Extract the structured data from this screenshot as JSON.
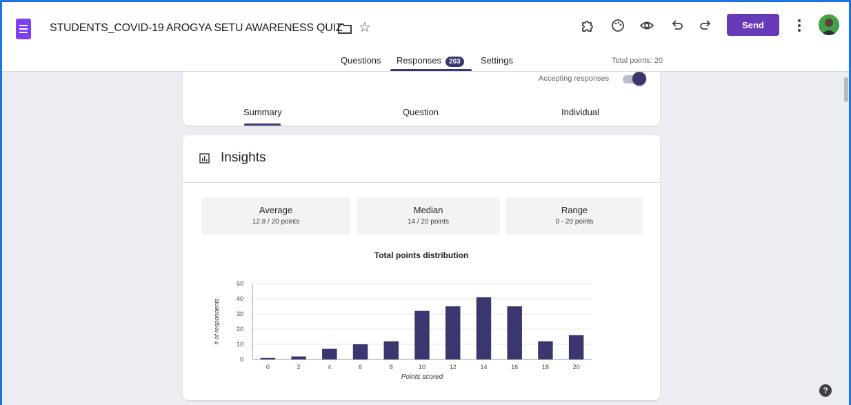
{
  "header": {
    "title": "STUDENTS_COVID-19 AROGYA SETU AWARENESS QUIZ",
    "send_label": "Send",
    "tabs": [
      {
        "label": "Questions"
      },
      {
        "label": "Responses",
        "badge": "203"
      },
      {
        "label": "Settings"
      }
    ],
    "total_points": "Total points: 20",
    "icons": [
      "folder-icon",
      "star-icon",
      "addon-icon",
      "palette-icon",
      "preview-icon",
      "undo-icon",
      "redo-icon",
      "more-vert-icon",
      "avatar"
    ]
  },
  "responses": {
    "accepting_label": "Accepting responses",
    "accepting_on": true,
    "subtabs": [
      "Summary",
      "Question",
      "Individual"
    ]
  },
  "insights": {
    "title": "Insights",
    "stats": [
      {
        "label": "Average",
        "value": "12.8 / 20 points"
      },
      {
        "label": "Median",
        "value": "14 / 20 points"
      },
      {
        "label": "Range",
        "value": "0 - 20 points"
      }
    ]
  },
  "colors": {
    "accent": "#673ab7",
    "bar": "#3a3770",
    "frame": "#1a73e8"
  },
  "chart_data": {
    "type": "bar",
    "title": "Total points distribution",
    "xlabel": "Points scored",
    "ylabel": "# of respondents",
    "categories": [
      "0",
      "2",
      "4",
      "6",
      "8",
      "10",
      "12",
      "14",
      "16",
      "18",
      "20"
    ],
    "values": [
      1,
      2,
      7,
      10,
      12,
      32,
      35,
      41,
      35,
      12,
      16
    ],
    "ylim": [
      0,
      50
    ],
    "yticks": [
      0,
      10,
      20,
      30,
      40,
      50
    ],
    "grid": true
  }
}
